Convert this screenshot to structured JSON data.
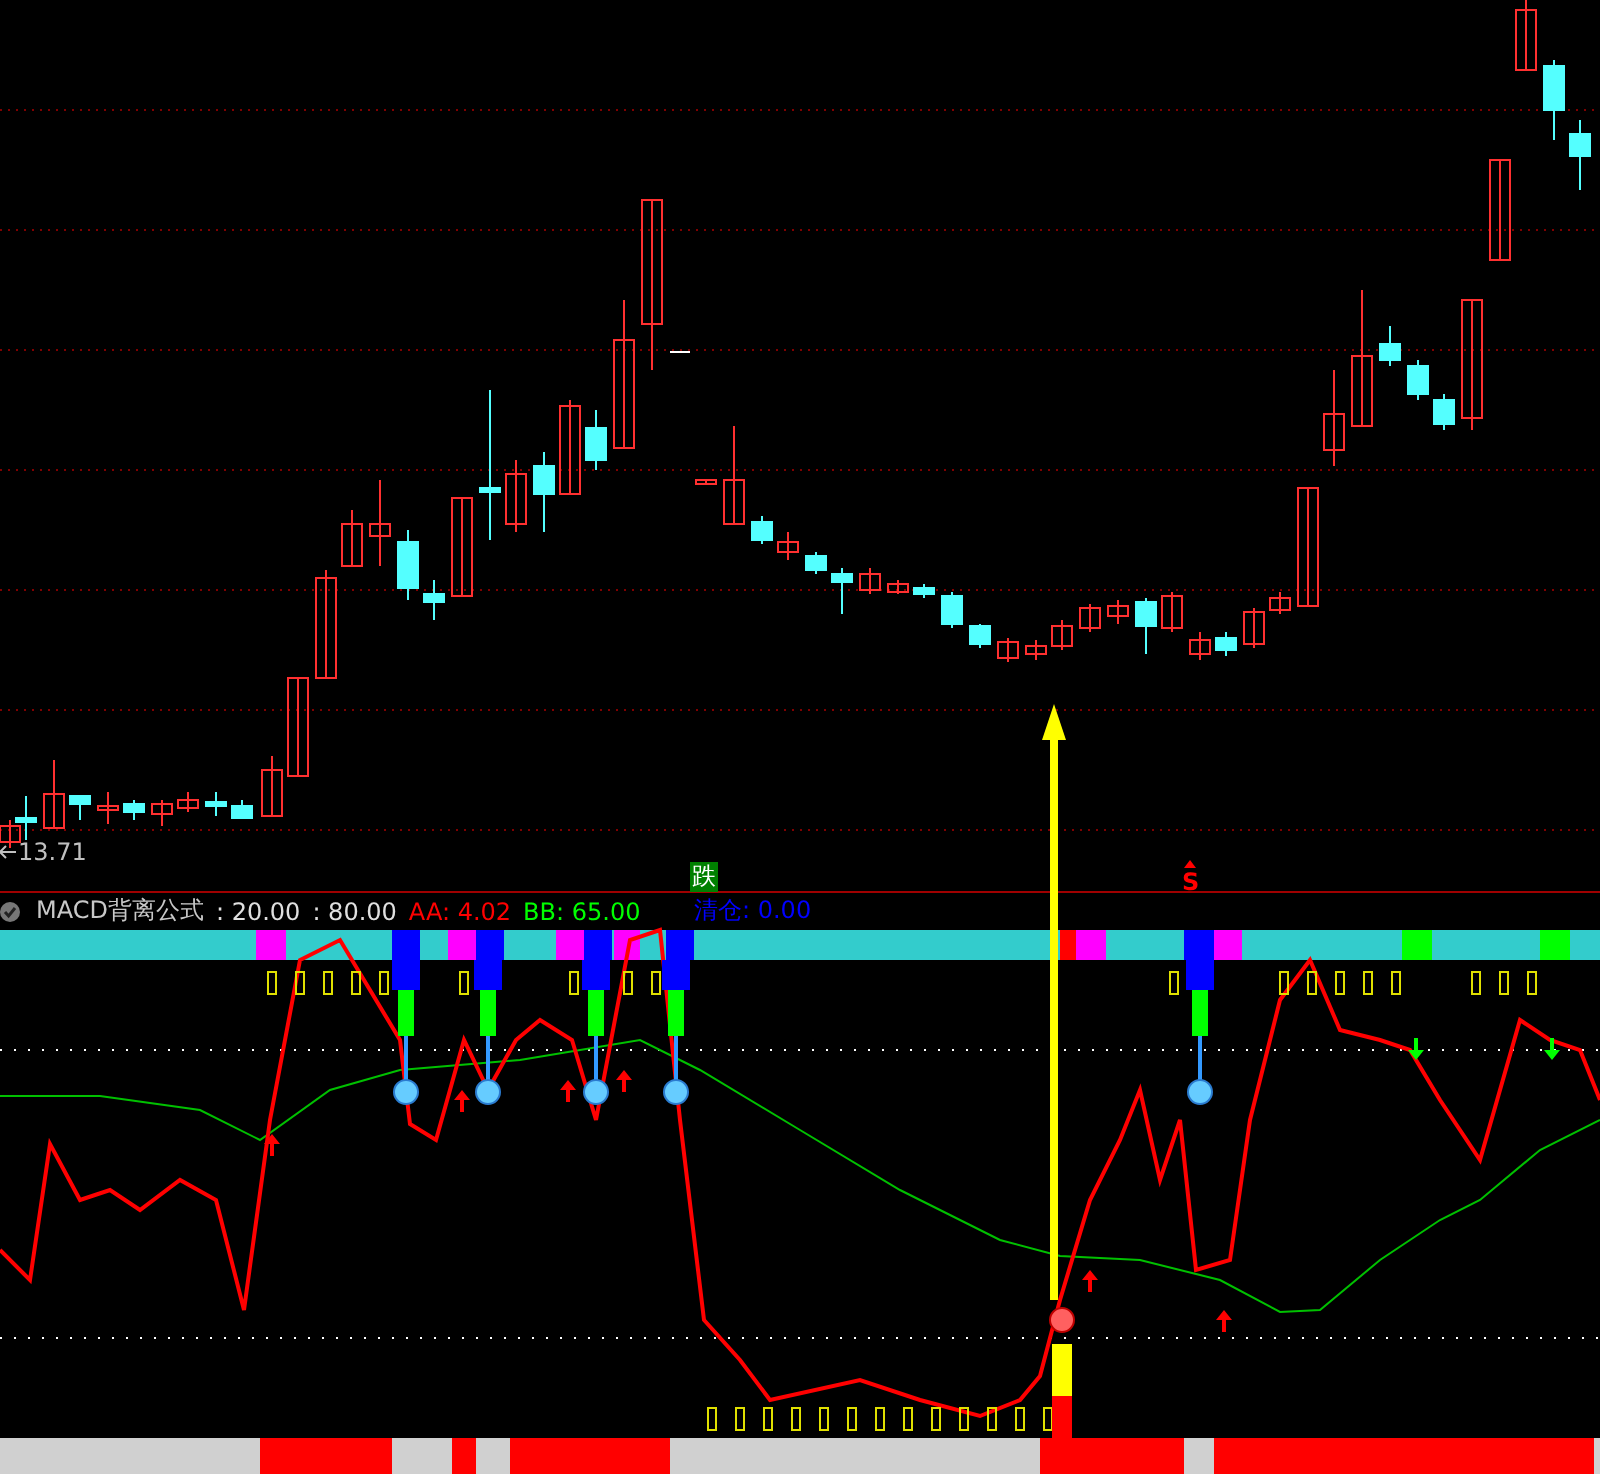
{
  "price_panel": {
    "low_label": "13.71",
    "signals": [
      {
        "text": "跌",
        "kind": "boxed"
      },
      {
        "text": "S",
        "kind": "arrow"
      }
    ]
  },
  "indicator": {
    "name": "MACD背离公式",
    "params": [
      ": 20.00",
      ": 80.00"
    ],
    "values": [
      {
        "label": "AA: 4.02",
        "color": "#ff0000"
      },
      {
        "label": "BB: 65.00",
        "color": "#00ff00"
      },
      {
        "label": "清仓: 0.00",
        "color": "#0000ff"
      }
    ]
  }
}
